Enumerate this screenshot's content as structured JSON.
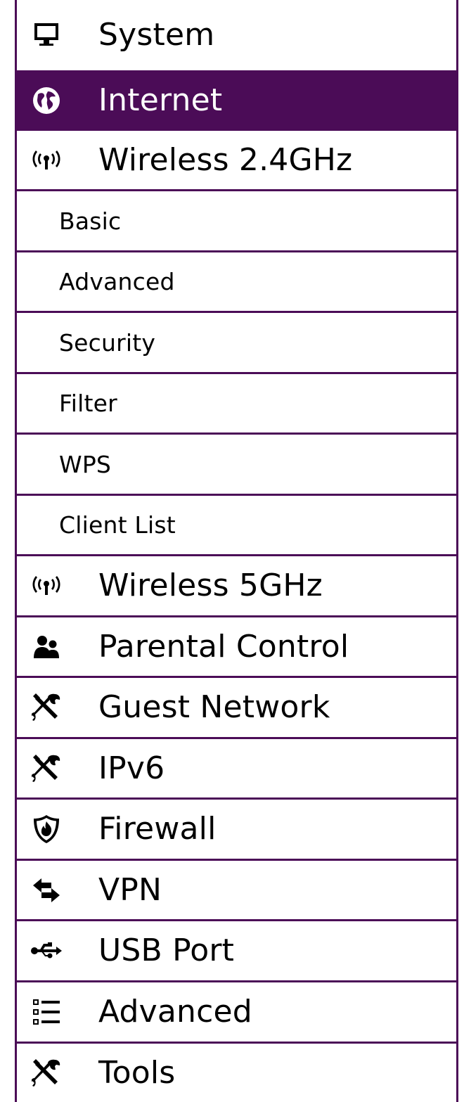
{
  "accent_color": "#4b0c57",
  "menu": {
    "items": [
      {
        "label": "System",
        "icon": "monitor-icon",
        "type": "top",
        "active": false
      },
      {
        "label": "Internet",
        "icon": "globe-icon",
        "type": "top",
        "active": true
      },
      {
        "label": "Wireless 2.4GHz",
        "icon": "wireless-icon",
        "type": "top",
        "active": false
      },
      {
        "label": "Basic",
        "type": "sub",
        "active": false
      },
      {
        "label": "Advanced",
        "type": "sub",
        "active": false
      },
      {
        "label": "Security",
        "type": "sub",
        "active": false
      },
      {
        "label": "Filter",
        "type": "sub",
        "active": false
      },
      {
        "label": "WPS",
        "type": "sub",
        "active": false
      },
      {
        "label": "Client List",
        "type": "sub",
        "active": false
      },
      {
        "label": "Wireless 5GHz",
        "icon": "wireless-icon",
        "type": "top",
        "active": false
      },
      {
        "label": "Parental Control",
        "icon": "users-icon",
        "type": "top",
        "active": false
      },
      {
        "label": "Guest Network",
        "icon": "wrench-screwdriver-icon",
        "type": "top",
        "active": false
      },
      {
        "label": "IPv6",
        "icon": "wrench-screwdriver-icon",
        "type": "top",
        "active": false
      },
      {
        "label": "Firewall",
        "icon": "shield-fire-icon",
        "type": "top",
        "active": false
      },
      {
        "label": "VPN",
        "icon": "exchange-arrows-icon",
        "type": "top",
        "active": false
      },
      {
        "label": "USB Port",
        "icon": "usb-icon",
        "type": "top",
        "active": false
      },
      {
        "label": "Advanced",
        "icon": "list-icon",
        "type": "top",
        "active": false
      },
      {
        "label": "Tools",
        "icon": "wrench-screwdriver-icon",
        "type": "top",
        "active": false
      }
    ]
  }
}
